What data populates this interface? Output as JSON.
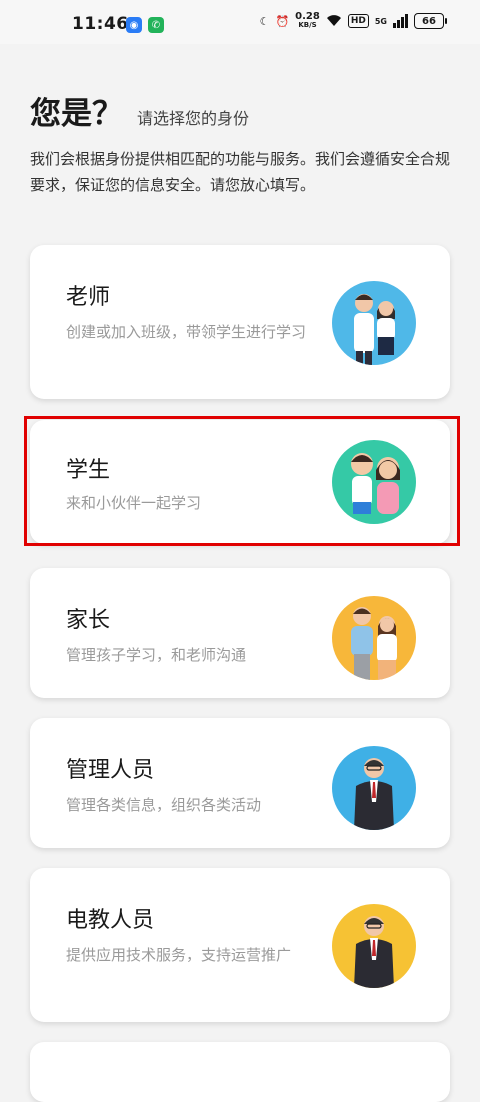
{
  "status_bar": {
    "time": "11:46",
    "net_speed": "0.28",
    "net_unit": "KB/S",
    "hd": "HD",
    "net_type": "5G",
    "battery": "66"
  },
  "header": {
    "title": "您是？",
    "subtitle": "请选择您的身份",
    "description": "我们会根据身份提供相匹配的功能与服务。我们会遵循安全合规要求，保证您的信息安全。请您放心填写。"
  },
  "roles": [
    {
      "title": "老师",
      "text": "创建或加入班级，带领学生进行学习",
      "avatar_bg": "#4fb8e8"
    },
    {
      "title": "学生",
      "text": "来和小伙伴一起学习",
      "avatar_bg": "#35c9a6"
    },
    {
      "title": "家长",
      "text": "管理孩子学习，和老师沟通",
      "avatar_bg": "#f7b73a"
    },
    {
      "title": "管理人员",
      "text": "管理各类信息，组织各类活动",
      "avatar_bg": "#3fb0e6"
    },
    {
      "title": "电教人员",
      "text": "提供应用技术服务，支持运营推广",
      "avatar_bg": "#f6c234"
    }
  ],
  "selected_role": "学生"
}
